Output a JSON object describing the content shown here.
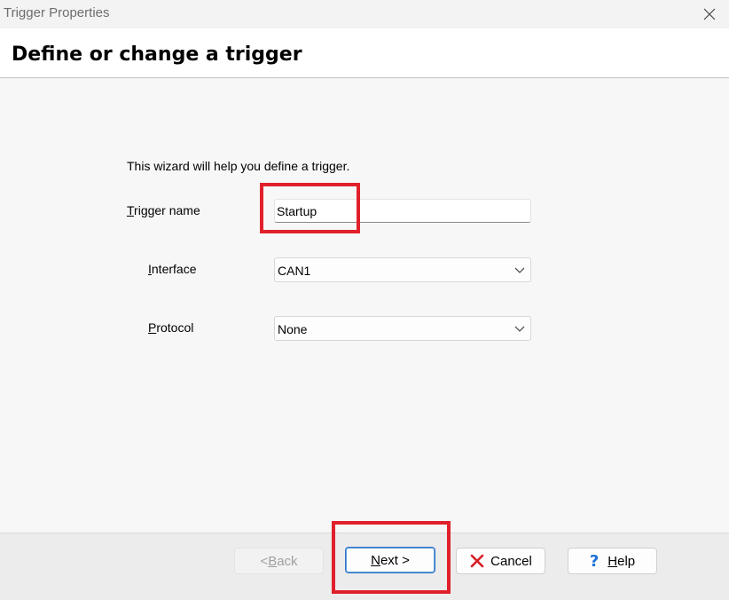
{
  "window": {
    "title": "Trigger Properties"
  },
  "header": {
    "title": "Define or change a trigger"
  },
  "form": {
    "intro": "This wizard will help you define a trigger.",
    "trigger_name": {
      "label_accel": "T",
      "label_rest": "rigger name",
      "value": "Startup"
    },
    "interface": {
      "label_accel": "I",
      "label_rest": "nterface",
      "value": "CAN1"
    },
    "protocol": {
      "label_accel": "P",
      "label_rest": "rotocol",
      "value": "None"
    }
  },
  "buttons": {
    "back": {
      "prefix": "< ",
      "accel": "B",
      "rest": "ack",
      "enabled": false
    },
    "next": {
      "accel": "N",
      "rest": "ext >"
    },
    "cancel": {
      "label": "Cancel",
      "icon": "red-x-icon"
    },
    "help": {
      "accel": "H",
      "rest": "elp",
      "icon": "question-mark-icon"
    }
  },
  "highlight_color": "#e0202a"
}
